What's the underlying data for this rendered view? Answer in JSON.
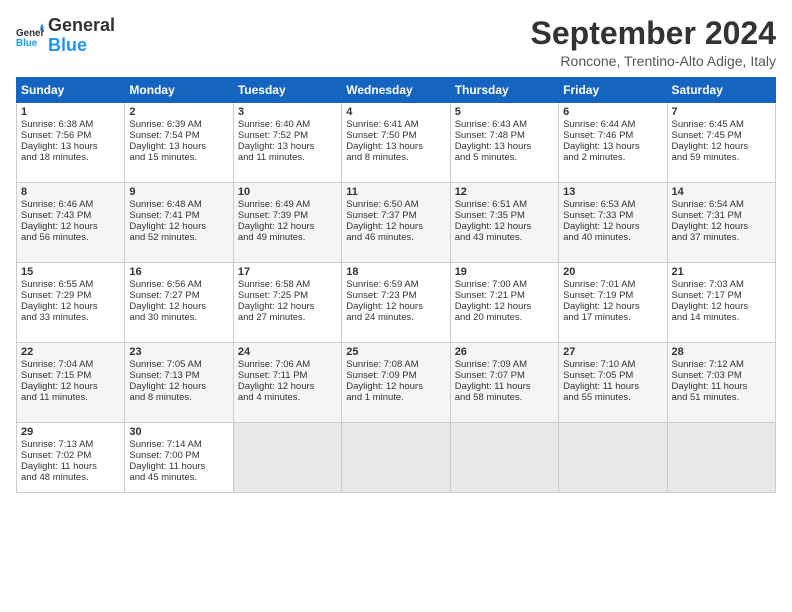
{
  "header": {
    "logo_general": "General",
    "logo_blue": "Blue",
    "month_title": "September 2024",
    "location": "Roncone, Trentino-Alto Adige, Italy"
  },
  "weekdays": [
    "Sunday",
    "Monday",
    "Tuesday",
    "Wednesday",
    "Thursday",
    "Friday",
    "Saturday"
  ],
  "weeks": [
    [
      {
        "day": "1",
        "lines": [
          "Sunrise: 6:38 AM",
          "Sunset: 7:56 PM",
          "Daylight: 13 hours",
          "and 18 minutes."
        ]
      },
      {
        "day": "2",
        "lines": [
          "Sunrise: 6:39 AM",
          "Sunset: 7:54 PM",
          "Daylight: 13 hours",
          "and 15 minutes."
        ]
      },
      {
        "day": "3",
        "lines": [
          "Sunrise: 6:40 AM",
          "Sunset: 7:52 PM",
          "Daylight: 13 hours",
          "and 11 minutes."
        ]
      },
      {
        "day": "4",
        "lines": [
          "Sunrise: 6:41 AM",
          "Sunset: 7:50 PM",
          "Daylight: 13 hours",
          "and 8 minutes."
        ]
      },
      {
        "day": "5",
        "lines": [
          "Sunrise: 6:43 AM",
          "Sunset: 7:48 PM",
          "Daylight: 13 hours",
          "and 5 minutes."
        ]
      },
      {
        "day": "6",
        "lines": [
          "Sunrise: 6:44 AM",
          "Sunset: 7:46 PM",
          "Daylight: 13 hours",
          "and 2 minutes."
        ]
      },
      {
        "day": "7",
        "lines": [
          "Sunrise: 6:45 AM",
          "Sunset: 7:45 PM",
          "Daylight: 12 hours",
          "and 59 minutes."
        ]
      }
    ],
    [
      {
        "day": "8",
        "lines": [
          "Sunrise: 6:46 AM",
          "Sunset: 7:43 PM",
          "Daylight: 12 hours",
          "and 56 minutes."
        ]
      },
      {
        "day": "9",
        "lines": [
          "Sunrise: 6:48 AM",
          "Sunset: 7:41 PM",
          "Daylight: 12 hours",
          "and 52 minutes."
        ]
      },
      {
        "day": "10",
        "lines": [
          "Sunrise: 6:49 AM",
          "Sunset: 7:39 PM",
          "Daylight: 12 hours",
          "and 49 minutes."
        ]
      },
      {
        "day": "11",
        "lines": [
          "Sunrise: 6:50 AM",
          "Sunset: 7:37 PM",
          "Daylight: 12 hours",
          "and 46 minutes."
        ]
      },
      {
        "day": "12",
        "lines": [
          "Sunrise: 6:51 AM",
          "Sunset: 7:35 PM",
          "Daylight: 12 hours",
          "and 43 minutes."
        ]
      },
      {
        "day": "13",
        "lines": [
          "Sunrise: 6:53 AM",
          "Sunset: 7:33 PM",
          "Daylight: 12 hours",
          "and 40 minutes."
        ]
      },
      {
        "day": "14",
        "lines": [
          "Sunrise: 6:54 AM",
          "Sunset: 7:31 PM",
          "Daylight: 12 hours",
          "and 37 minutes."
        ]
      }
    ],
    [
      {
        "day": "15",
        "lines": [
          "Sunrise: 6:55 AM",
          "Sunset: 7:29 PM",
          "Daylight: 12 hours",
          "and 33 minutes."
        ]
      },
      {
        "day": "16",
        "lines": [
          "Sunrise: 6:56 AM",
          "Sunset: 7:27 PM",
          "Daylight: 12 hours",
          "and 30 minutes."
        ]
      },
      {
        "day": "17",
        "lines": [
          "Sunrise: 6:58 AM",
          "Sunset: 7:25 PM",
          "Daylight: 12 hours",
          "and 27 minutes."
        ]
      },
      {
        "day": "18",
        "lines": [
          "Sunrise: 6:59 AM",
          "Sunset: 7:23 PM",
          "Daylight: 12 hours",
          "and 24 minutes."
        ]
      },
      {
        "day": "19",
        "lines": [
          "Sunrise: 7:00 AM",
          "Sunset: 7:21 PM",
          "Daylight: 12 hours",
          "and 20 minutes."
        ]
      },
      {
        "day": "20",
        "lines": [
          "Sunrise: 7:01 AM",
          "Sunset: 7:19 PM",
          "Daylight: 12 hours",
          "and 17 minutes."
        ]
      },
      {
        "day": "21",
        "lines": [
          "Sunrise: 7:03 AM",
          "Sunset: 7:17 PM",
          "Daylight: 12 hours",
          "and 14 minutes."
        ]
      }
    ],
    [
      {
        "day": "22",
        "lines": [
          "Sunrise: 7:04 AM",
          "Sunset: 7:15 PM",
          "Daylight: 12 hours",
          "and 11 minutes."
        ]
      },
      {
        "day": "23",
        "lines": [
          "Sunrise: 7:05 AM",
          "Sunset: 7:13 PM",
          "Daylight: 12 hours",
          "and 8 minutes."
        ]
      },
      {
        "day": "24",
        "lines": [
          "Sunrise: 7:06 AM",
          "Sunset: 7:11 PM",
          "Daylight: 12 hours",
          "and 4 minutes."
        ]
      },
      {
        "day": "25",
        "lines": [
          "Sunrise: 7:08 AM",
          "Sunset: 7:09 PM",
          "Daylight: 12 hours",
          "and 1 minute."
        ]
      },
      {
        "day": "26",
        "lines": [
          "Sunrise: 7:09 AM",
          "Sunset: 7:07 PM",
          "Daylight: 11 hours",
          "and 58 minutes."
        ]
      },
      {
        "day": "27",
        "lines": [
          "Sunrise: 7:10 AM",
          "Sunset: 7:05 PM",
          "Daylight: 11 hours",
          "and 55 minutes."
        ]
      },
      {
        "day": "28",
        "lines": [
          "Sunrise: 7:12 AM",
          "Sunset: 7:03 PM",
          "Daylight: 11 hours",
          "and 51 minutes."
        ]
      }
    ],
    [
      {
        "day": "29",
        "lines": [
          "Sunrise: 7:13 AM",
          "Sunset: 7:02 PM",
          "Daylight: 11 hours",
          "and 48 minutes."
        ]
      },
      {
        "day": "30",
        "lines": [
          "Sunrise: 7:14 AM",
          "Sunset: 7:00 PM",
          "Daylight: 11 hours",
          "and 45 minutes."
        ]
      },
      {
        "day": "",
        "lines": []
      },
      {
        "day": "",
        "lines": []
      },
      {
        "day": "",
        "lines": []
      },
      {
        "day": "",
        "lines": []
      },
      {
        "day": "",
        "lines": []
      }
    ]
  ]
}
